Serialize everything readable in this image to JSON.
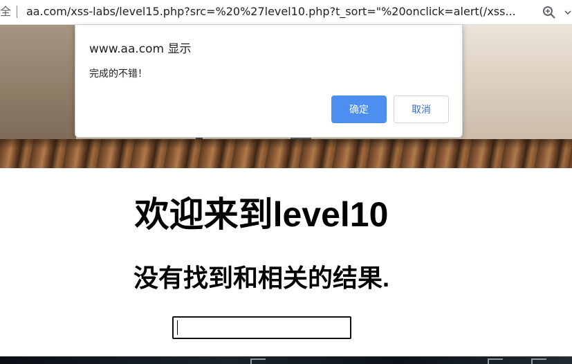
{
  "browser": {
    "security_label": "全",
    "url": "aa.com/xss-labs/level15.php?src=%20%27level10.php?t_sort=\"%20onclick=alert(/xss..."
  },
  "dialog": {
    "origin": "www.aa.com 显示",
    "message": "完成的不错！",
    "ok_label": "确定",
    "cancel_label": "取消"
  },
  "page": {
    "heading": "欢迎来到level10",
    "result_text": "没有找到和相关的结果.",
    "search_value": ""
  },
  "colors": {
    "ok_button": "#4d8ff1",
    "cancel_text": "#3a6fc4"
  },
  "icons": {
    "zoom": "zoom-icon",
    "menu": "chevron-down-icon"
  }
}
